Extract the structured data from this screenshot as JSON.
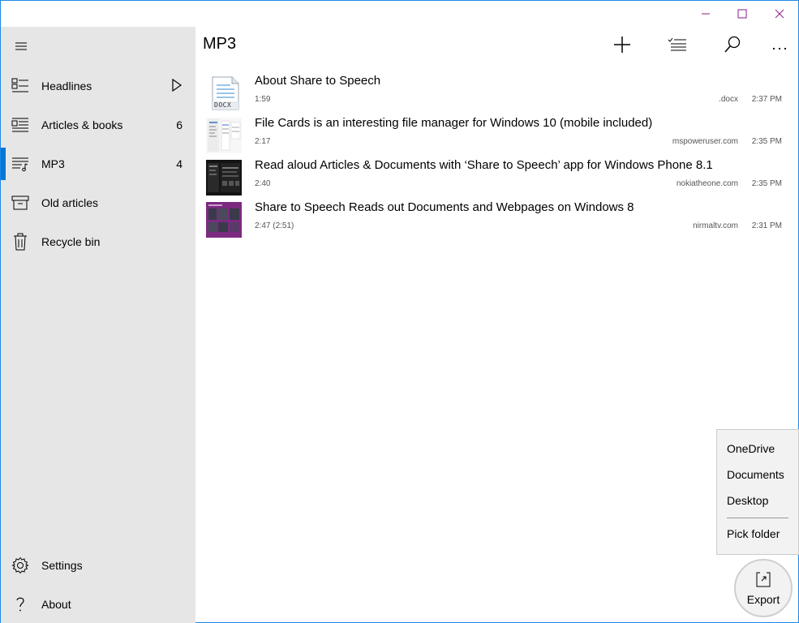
{
  "window": {
    "minimize_icon": "minimize-icon",
    "maximize_icon": "maximize-icon",
    "close_icon": "close-icon",
    "caption_color": "#8a1c8a"
  },
  "sidebar": {
    "menu_icon": "hamburger-icon",
    "items": [
      {
        "label": "Headlines",
        "icon": "headlines-icon",
        "extra": "play-icon"
      },
      {
        "label": "Articles & books",
        "icon": "articles-icon",
        "count": "6"
      },
      {
        "label": "MP3",
        "icon": "mp3-list-icon",
        "count": "4",
        "selected": true
      },
      {
        "label": "Old articles",
        "icon": "archive-icon"
      },
      {
        "label": "Recycle bin",
        "icon": "trash-icon"
      }
    ],
    "bottom": [
      {
        "label": "Settings",
        "icon": "gear-icon"
      },
      {
        "label": "About",
        "icon": "question-icon"
      }
    ],
    "accent": "#0078d7"
  },
  "header": {
    "title": "MP3",
    "buttons": [
      "add-icon",
      "select-list-icon",
      "search-icon",
      "more-icon"
    ]
  },
  "list": [
    {
      "title": "About Share to Speech",
      "duration": "1:59",
      "source": ".docx",
      "time": "2:37 PM",
      "thumb": "docx"
    },
    {
      "title": "File Cards is an interesting file manager for Windows 10 (mobile included)",
      "duration": "2:17",
      "source": "mspoweruser.com",
      "time": "2:35 PM",
      "thumb": "screenshot-light"
    },
    {
      "title": "Read aloud Articles & Documents with ‘Share to Speech’ app for Windows Phone 8.1",
      "duration": "2:40",
      "source": "nokiatheone.com",
      "time": "2:35 PM",
      "thumb": "screenshot-dark"
    },
    {
      "title": "Share to Speech Reads out Documents and Webpages on Windows 8",
      "duration": "2:47 (2:51)",
      "source": "nirmaltv.com",
      "time": "2:31 PM",
      "thumb": "screenshot-purple"
    }
  ],
  "thumb_docx_label": "DOCX",
  "flyout": {
    "items": [
      "OneDrive",
      "Documents",
      "Desktop"
    ],
    "pick": "Pick folder"
  },
  "export": {
    "label": "Export",
    "icon": "export-icon"
  }
}
